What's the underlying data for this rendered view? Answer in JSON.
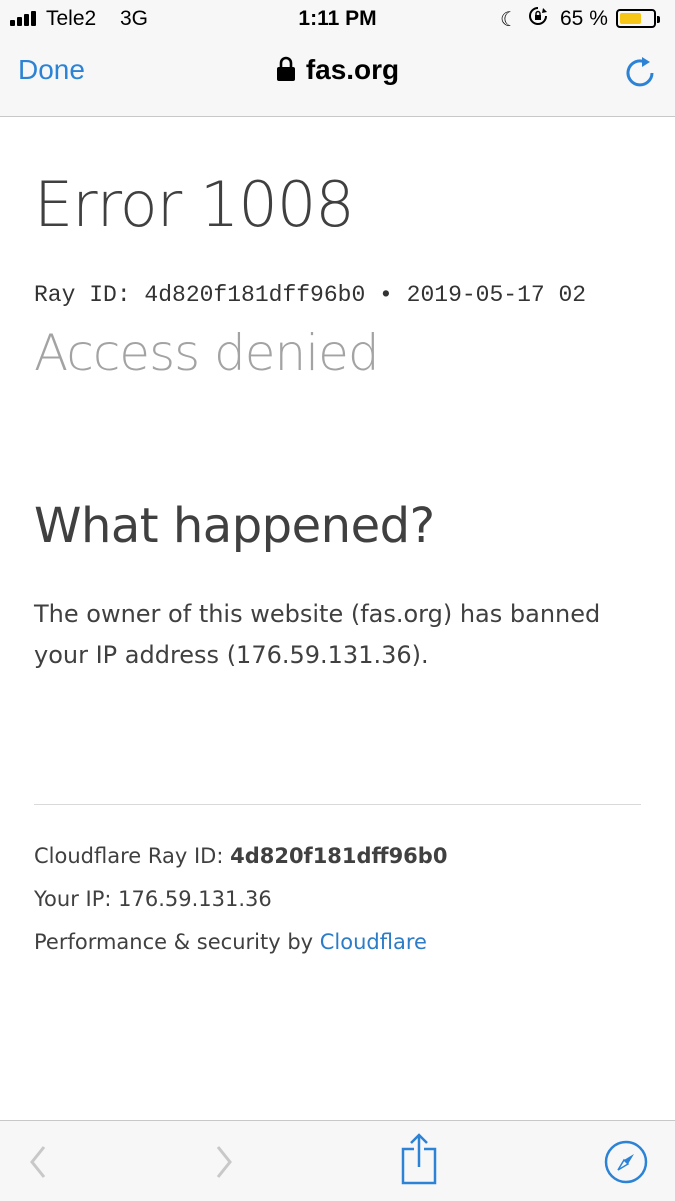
{
  "status": {
    "carrier": "Tele2",
    "network": "3G",
    "time": "1:11 PM",
    "battery_percent": "65 %",
    "battery_level": 0.65,
    "battery_color": "#f5c518"
  },
  "nav": {
    "done_label": "Done",
    "url": "fas.org",
    "accent": "#2c83d5"
  },
  "page": {
    "error_title": "Error 1008",
    "ray_line": "Ray ID: 4d820f181dff96b0 • 2019-05-17 02",
    "access_denied": "Access denied",
    "what_happened": "What happened?",
    "explanation": "The owner of this website (fas.org) has banned your IP address (176.59.131.36).",
    "footer": {
      "ray_label": "Cloudflare Ray ID: ",
      "ray_value": "4d820f181dff96b0",
      "ip_line": "Your IP: 176.59.131.36",
      "perf_label": "Performance & security by ",
      "perf_link": "Cloudflare"
    }
  },
  "toolbar": {
    "icons": [
      "back-icon",
      "forward-icon",
      "share-icon",
      "safari-compass-icon"
    ]
  }
}
